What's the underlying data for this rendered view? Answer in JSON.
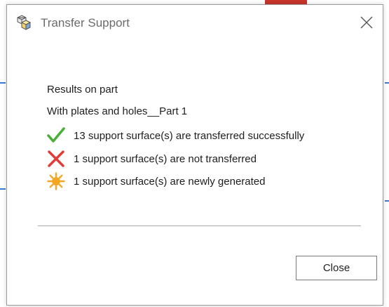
{
  "window": {
    "title": "Transfer Support",
    "icon": "parts-cubes-icon"
  },
  "content": {
    "heading": "Results on part",
    "part_name": "With plates and holes__Part 1",
    "results": [
      {
        "icon": "check-icon",
        "color": "#4caf3a",
        "text": "13 support surface(s) are transferred successfully"
      },
      {
        "icon": "cross-icon",
        "color": "#e53935",
        "text": "1 support surface(s) are not transferred"
      },
      {
        "icon": "sun-burst-icon",
        "color": "#f5a623",
        "text": "1 support surface(s) are newly generated"
      }
    ]
  },
  "buttons": {
    "close_label": "Close"
  }
}
